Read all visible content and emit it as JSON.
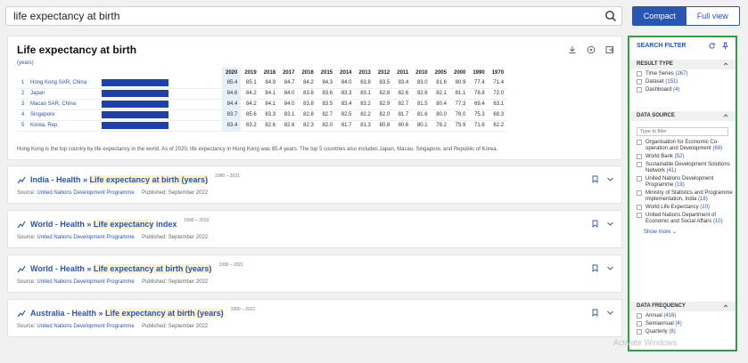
{
  "search": {
    "query": "life expectancy at birth"
  },
  "view_toggle": {
    "compact": "Compact",
    "full": "Full view"
  },
  "main": {
    "title": "Life expectancy at birth",
    "unit": "(years)",
    "years": [
      "2020",
      "2019",
      "2018",
      "2017",
      "2016",
      "2015",
      "2014",
      "2013",
      "2012",
      "2011",
      "2010",
      "2005",
      "2000",
      "1990",
      "1970"
    ],
    "rows": [
      {
        "num": "1",
        "country": "Hong Kong SAR, China",
        "bar": 1.0,
        "values": [
          "85.4",
          "85.1",
          "84.9",
          "84.7",
          "84.2",
          "84.3",
          "84.0",
          "83.8",
          "83.5",
          "83.4",
          "83.0",
          "81.6",
          "80.9",
          "77.4",
          "71.4"
        ]
      },
      {
        "num": "2",
        "country": "Japan",
        "bar": 1.0,
        "values": [
          "84.6",
          "84.2",
          "84.1",
          "84.0",
          "83.8",
          "83.6",
          "83.3",
          "83.1",
          "82.8",
          "82.6",
          "82.6",
          "82.1",
          "81.1",
          "78.8",
          "72.0"
        ]
      },
      {
        "num": "3",
        "country": "Macao SAR, China",
        "bar": 1.0,
        "values": [
          "84.4",
          "84.2",
          "84.1",
          "84.0",
          "83.8",
          "83.5",
          "83.4",
          "83.2",
          "82.9",
          "82.7",
          "81.5",
          "80.4",
          "77.3",
          "69.4",
          "63.1"
        ]
      },
      {
        "num": "4",
        "country": "Singapore",
        "bar": 1.0,
        "values": [
          "83.7",
          "85.6",
          "83.3",
          "83.1",
          "82.8",
          "82.7",
          "82.5",
          "82.2",
          "82.0",
          "81.7",
          "81.6",
          "80.0",
          "78.0",
          "75.3",
          "68.3"
        ]
      },
      {
        "num": "5",
        "country": "Korea, Rep.",
        "bar": 1.0,
        "values": [
          "83.4",
          "83.2",
          "82.6",
          "82.6",
          "82.3",
          "82.0",
          "81.7",
          "81.3",
          "80.8",
          "80.6",
          "80.1",
          "78.2",
          "75.9",
          "71.6",
          "62.2"
        ]
      }
    ],
    "summary": "Hong Kong is the top country by life expectancy in the world. As of 2020, life expectancy in Hong Kong was 85.4 years. The top 5 countries also includes Japan, Macau, Singapore, and Republic of Korea."
  },
  "results": [
    {
      "prefix": "India - Health » ",
      "highlight": "Life expectancy at birth (years)",
      "suffix": "",
      "range": "1990 – 2021",
      "source_label": "Source:",
      "source": "United Nations Development Programme",
      "published": "Published: September 2022"
    },
    {
      "prefix": "World - Health » ",
      "highlight": "Life expectancy",
      "suffix": " index",
      "range": "1990 – 2019",
      "source_label": "Source:",
      "source": "United Nations Development Programme",
      "published": "Published: September 2022"
    },
    {
      "prefix": "World - Health » ",
      "highlight": "Life expectancy at birth (years)",
      "suffix": "",
      "range": "1990 – 2021",
      "source_label": "Source:",
      "source": "United Nations Development Programme",
      "published": "Published: September 2022"
    },
    {
      "prefix": "Australia - Health » ",
      "highlight": "Life expectancy at birth (years)",
      "suffix": "",
      "range": "1990 – 2021",
      "source_label": "Source:",
      "source": "United Nations Development Programme",
      "published": "Published: September 2022"
    }
  ],
  "filter": {
    "title": "SEARCH FILTER",
    "result_type": {
      "title": "RESULT TYPE",
      "options": [
        {
          "label": "Time Series",
          "count": "(267)"
        },
        {
          "label": "Dataset",
          "count": "(151)"
        },
        {
          "label": "Dashboard",
          "count": "(4)"
        }
      ]
    },
    "data_source": {
      "title": "DATA SOURCE",
      "placeholder": "Type to filter",
      "options": [
        {
          "label": "Organisation for Economic Co-operation and Development",
          "count": "(69)"
        },
        {
          "label": "World Bank",
          "count": "(52)"
        },
        {
          "label": "Sustainable Development Solutions Network",
          "count": "(41)"
        },
        {
          "label": "United Nations Development Programme",
          "count": "(19)"
        },
        {
          "label": "Ministry of Statistics and Programme Implementation, India",
          "count": "(18)"
        },
        {
          "label": "World Life Expectancy",
          "count": "(10)"
        },
        {
          "label": "United Nations Department of Economic and Social Affairs",
          "count": "(10)"
        }
      ],
      "show_more": "Show more"
    },
    "data_frequency": {
      "title": "DATA FREQUENCY",
      "options": [
        {
          "label": "Annual",
          "count": "(416)"
        },
        {
          "label": "Semiannual",
          "count": "(4)"
        },
        {
          "label": "Quarterly",
          "count": "(8)"
        }
      ]
    }
  },
  "watermark": "Activate Windows"
}
